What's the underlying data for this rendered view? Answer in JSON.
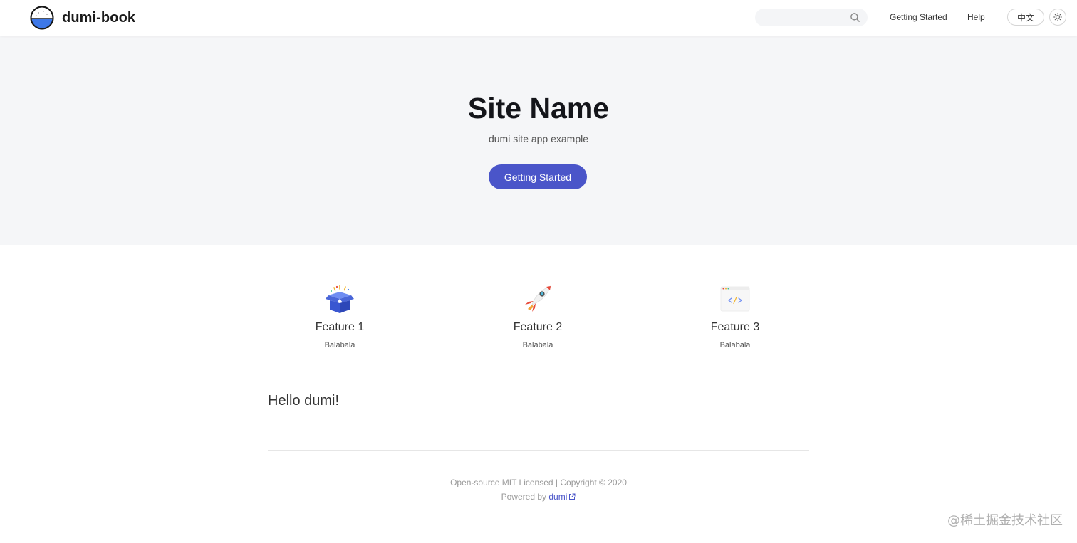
{
  "header": {
    "logo_text": "dumi-book",
    "search": {
      "placeholder": "",
      "value": ""
    },
    "nav": [
      "Getting Started",
      "Help"
    ],
    "lang_label": "中文",
    "icons": {
      "search": "search-icon",
      "theme": "sun-icon"
    }
  },
  "hero": {
    "title": "Site Name",
    "description": "dumi site app example",
    "action_label": "Getting Started"
  },
  "features": [
    {
      "title": "Feature 1",
      "description": "Balabala",
      "icon": "gift-box-icon"
    },
    {
      "title": "Feature 2",
      "description": "Balabala",
      "icon": "rocket-icon"
    },
    {
      "title": "Feature 3",
      "description": "Balabala",
      "icon": "code-window-icon"
    }
  ],
  "content": {
    "heading": "Hello dumi!"
  },
  "footer": {
    "line1": "Open-source MIT Licensed | Copyright © 2020",
    "powered_prefix": "Powered by",
    "powered_link": "dumi"
  },
  "watermark": "@稀土掘金技术社区",
  "colors": {
    "primary": "#4a55c9",
    "hero_background": "#f5f6f8",
    "title": "#14151a"
  }
}
